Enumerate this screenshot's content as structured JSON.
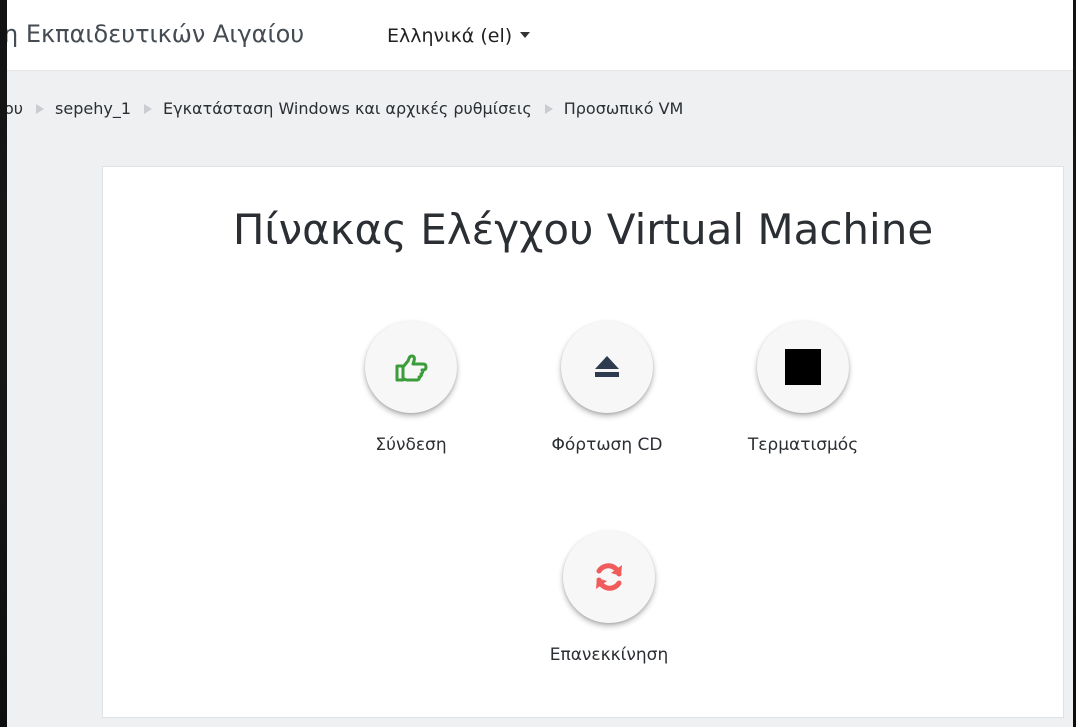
{
  "navbar": {
    "site_name": "η Εκπαιδευτικών Αιγαίου",
    "language": "Ελληνικά (el)"
  },
  "breadcrumb": [
    "ου",
    "sepehy_1",
    "Εγκατάσταση Windows και αρχικές ρυθμίσεις",
    "Προσωπικό VM"
  ],
  "panel": {
    "title": "Πίνακας Ελέγχου Virtual Machine",
    "controls": [
      {
        "label": "Σύνδεση",
        "icon": "thumbs-up-icon",
        "color": "#3a9d3a"
      },
      {
        "label": "Φόρτωση CD",
        "icon": "eject-icon",
        "color": "#2e3a4d"
      },
      {
        "label": "Τερματισμός",
        "icon": "stop-icon",
        "color": "#000000"
      },
      {
        "label": "Επανεκκίνηση",
        "icon": "refresh-icon",
        "color": "#f05b5b"
      }
    ]
  }
}
